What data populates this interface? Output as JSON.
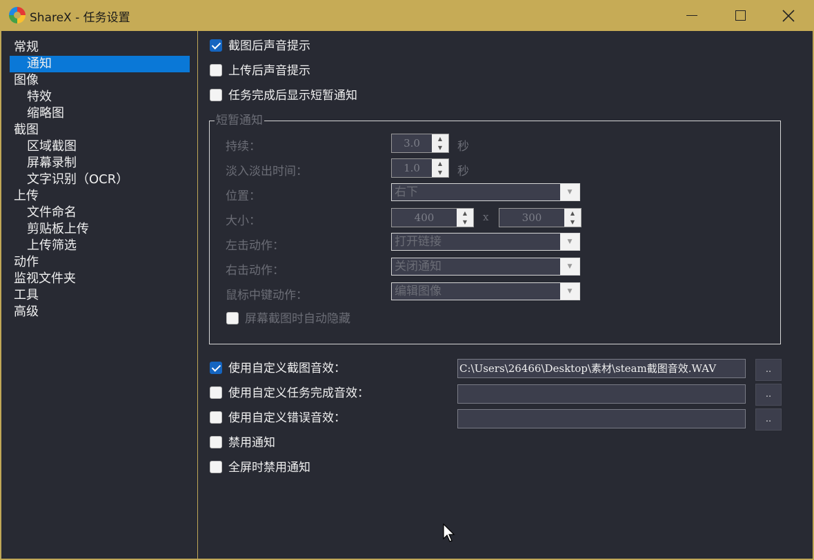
{
  "window": {
    "title": "ShareX - 任务设置"
  },
  "sidebar": {
    "items": [
      {
        "label": "常规"
      },
      {
        "label": "通知"
      },
      {
        "label": "图像"
      },
      {
        "label": "特效"
      },
      {
        "label": "缩略图"
      },
      {
        "label": "截图"
      },
      {
        "label": "区域截图"
      },
      {
        "label": "屏幕录制"
      },
      {
        "label": "文字识别（OCR）"
      },
      {
        "label": "上传"
      },
      {
        "label": "文件命名"
      },
      {
        "label": "剪贴板上传"
      },
      {
        "label": "上传筛选"
      },
      {
        "label": "动作"
      },
      {
        "label": "监视文件夹"
      },
      {
        "label": "工具"
      },
      {
        "label": "高级"
      }
    ],
    "selected": "通知"
  },
  "notifications": {
    "capture_sound": {
      "label": "截图后声音提示",
      "checked": true
    },
    "upload_sound": {
      "label": "上传后声音提示",
      "checked": false
    },
    "toast_on_complete": {
      "label": "任务完成后显示短暂通知",
      "checked": false
    }
  },
  "toast": {
    "group_title": "短暂通知",
    "duration_label": "持续：",
    "duration_value": "3.0",
    "duration_unit": "秒",
    "fade_label": "淡入淡出时间：",
    "fade_value": "1.0",
    "fade_unit": "秒",
    "position_label": "位置：",
    "position_value": "右下",
    "size_label": "大小：",
    "width_value": "400",
    "size_separator": "x",
    "height_value": "300",
    "left_click_label": "左击动作：",
    "left_click_value": "打开链接",
    "right_click_label": "右击动作：",
    "right_click_value": "关闭通知",
    "middle_click_label": "鼠标中键动作：",
    "middle_click_value": "编辑图像",
    "auto_hide": {
      "label": "屏幕截图时自动隐藏",
      "checked": false
    }
  },
  "custom_sounds": {
    "capture": {
      "label": "使用自定义截图音效：",
      "checked": true,
      "path": "C:\\Users\\26466\\Desktop\\素材\\steam截图音效.WAV"
    },
    "task_complete": {
      "label": "使用自定义任务完成音效：",
      "checked": false,
      "path": ""
    },
    "error": {
      "label": "使用自定义错误音效：",
      "checked": false,
      "path": ""
    },
    "browse_label": ".."
  },
  "disable_notifications": {
    "label": "禁用通知",
    "checked": false
  },
  "disable_fullscreen": {
    "label": "全屏时禁用通知",
    "checked": false
  },
  "colors": {
    "title_bar": "#c6ab56",
    "panel_bg": "#282a33",
    "selection": "#0a78d7",
    "checkbox_checked": "#1565c0"
  }
}
